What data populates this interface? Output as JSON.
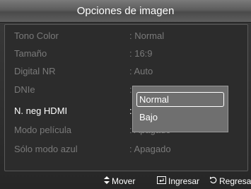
{
  "header": {
    "title": "Opciones de imagen"
  },
  "menu": [
    {
      "label": "Tono Color",
      "value": ": Normal"
    },
    {
      "label": "Tamaño",
      "value": ": 16:9"
    },
    {
      "label": "Digital NR",
      "value": ": Auto"
    },
    {
      "label": "DNIe",
      "value": ":"
    },
    {
      "label": "N. neg HDMI",
      "value": ":"
    },
    {
      "label": "Modo película",
      "value": ": Apagado"
    },
    {
      "label": "Sólo modo azul",
      "value": ": Apagado"
    }
  ],
  "dropdown": {
    "options": [
      "Normal",
      "Bajo"
    ],
    "selected": "Normal"
  },
  "footer": {
    "move": {
      "icon": "up-down-arrow-icon",
      "label": "Mover"
    },
    "enter": {
      "icon": "enter-icon",
      "label": "Ingresar"
    },
    "return": {
      "icon": "return-icon",
      "label": "Regresar"
    }
  }
}
